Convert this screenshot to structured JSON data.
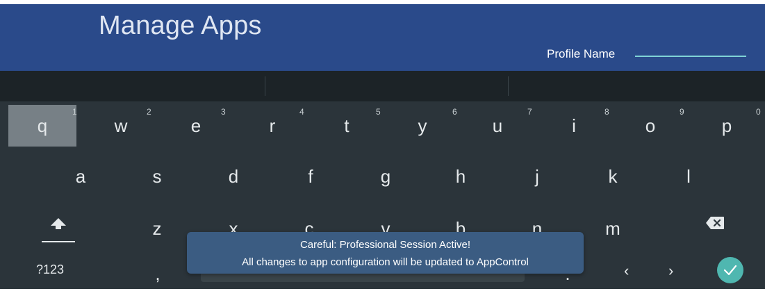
{
  "header": {
    "title": "Manage Apps",
    "profile_label": "Profile Name",
    "background_color": "#2a4a8a",
    "field_underline_color": "#7fd3d6"
  },
  "keyboard": {
    "row1": [
      {
        "label": "q",
        "hint": "1"
      },
      {
        "label": "w",
        "hint": "2"
      },
      {
        "label": "e",
        "hint": "3"
      },
      {
        "label": "r",
        "hint": "4"
      },
      {
        "label": "t",
        "hint": "5"
      },
      {
        "label": "y",
        "hint": "6"
      },
      {
        "label": "u",
        "hint": "7"
      },
      {
        "label": "i",
        "hint": "8"
      },
      {
        "label": "o",
        "hint": "9"
      },
      {
        "label": "p",
        "hint": "0"
      }
    ],
    "row2": [
      "a",
      "s",
      "d",
      "f",
      "g",
      "h",
      "j",
      "k",
      "l"
    ],
    "row3": [
      "z",
      "x",
      "c",
      "v",
      "b",
      "n",
      "m"
    ],
    "mode_key": "?123",
    "comma": ",",
    "period": ".",
    "nav_left": "‹",
    "nav_right": "›",
    "selected_key": "q",
    "enter_color": "#4fb7b0"
  },
  "toast": {
    "line1": "Careful: Professional Session Active!",
    "line2": "All changes to app configuration will be updated to AppControl"
  }
}
